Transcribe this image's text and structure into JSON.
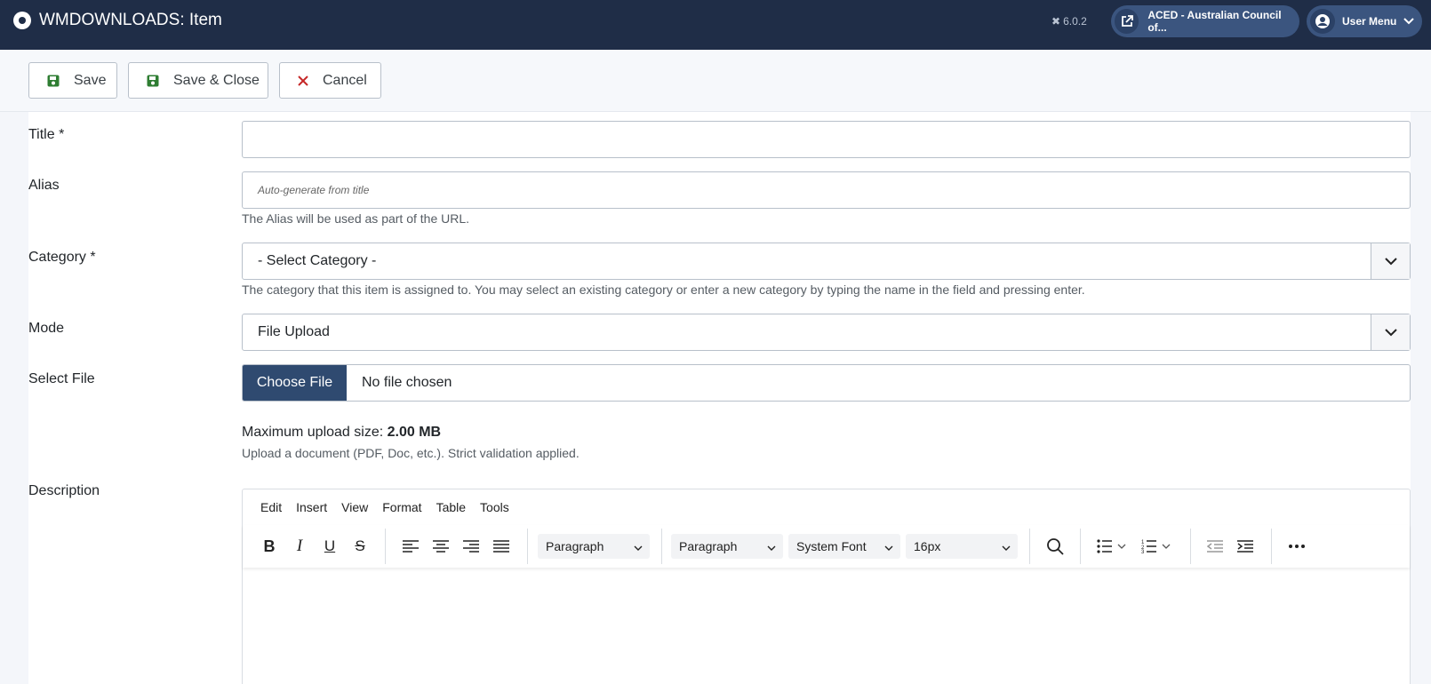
{
  "header": {
    "title": "WMDOWNLOADS: Item",
    "version": "6.0.2",
    "site_link": "ACED - Australian Council of...",
    "user_menu": "User Menu"
  },
  "toolbar": {
    "save": "Save",
    "save_close": "Save & Close",
    "cancel": "Cancel"
  },
  "form": {
    "title_label": "Title *",
    "title_value": "",
    "alias_label": "Alias",
    "alias_placeholder": "Auto-generate from title",
    "alias_help": "The Alias will be used as part of the URL.",
    "category_label": "Category *",
    "category_value": "- Select Category -",
    "category_help": "The category that this item is assigned to. You may select an existing category or enter a new category by typing the name in the field and pressing enter.",
    "mode_label": "Mode",
    "mode_value": "File Upload",
    "file_label": "Select File",
    "file_button": "Choose File",
    "file_status": "No file chosen",
    "max_upload_prefix": "Maximum upload size: ",
    "max_upload_value": "2.00 MB",
    "upload_help": "Upload a document (PDF, Doc, etc.). Strict validation applied.",
    "description_label": "Description"
  },
  "editor": {
    "menus": [
      "Edit",
      "Insert",
      "View",
      "Format",
      "Table",
      "Tools"
    ],
    "block_format_1": "Paragraph",
    "block_format_2": "Paragraph",
    "font_family": "System Font",
    "font_size": "16px"
  },
  "colors": {
    "header_bg": "#1f2d47",
    "pill_bg": "#3b557f",
    "save_icon": "#2e7d32",
    "cancel_icon": "#c62828",
    "choose_file_bg": "#2f4a70"
  }
}
